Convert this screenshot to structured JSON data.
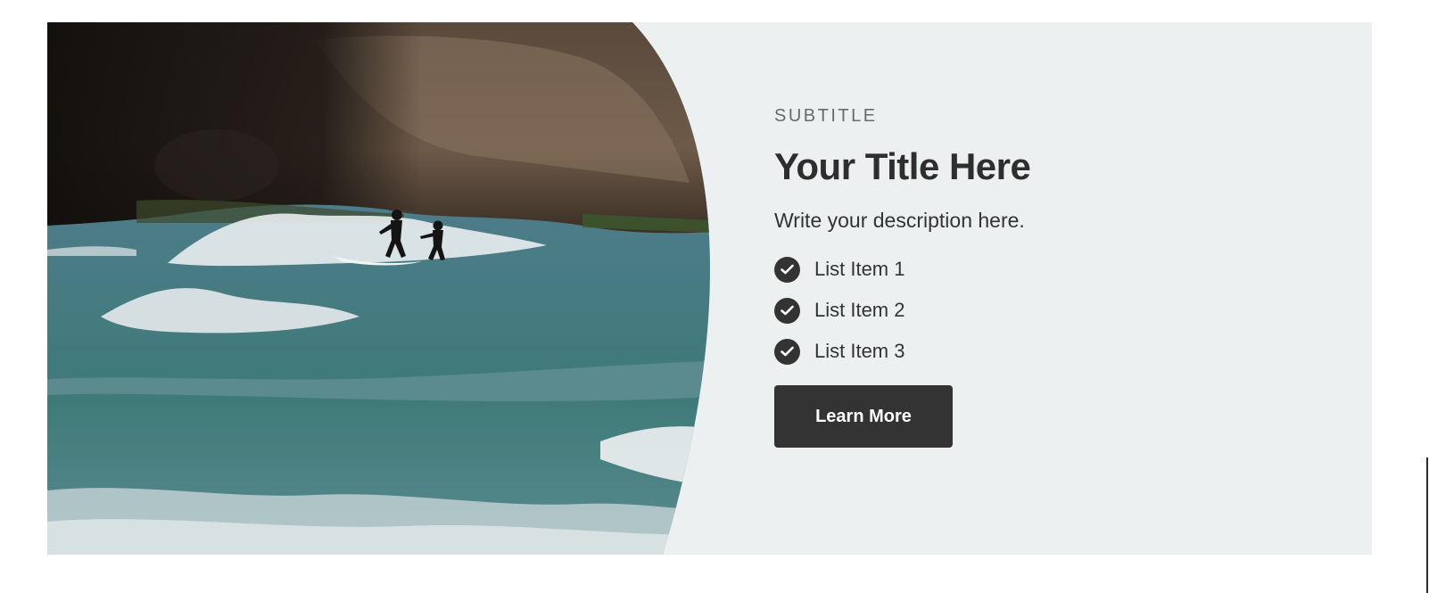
{
  "hero": {
    "subtitle": "SUBTITLE",
    "title": "Your Title Here",
    "description": "Write your description here.",
    "list_items": [
      "List Item 1",
      "List Item 2",
      "List Item 3"
    ],
    "button_label": "Learn More"
  },
  "colors": {
    "panel_background": "#edf0f1",
    "button_background": "#333333",
    "text": "#333333"
  },
  "icons": {
    "list_bullet": "check-circle-icon"
  }
}
